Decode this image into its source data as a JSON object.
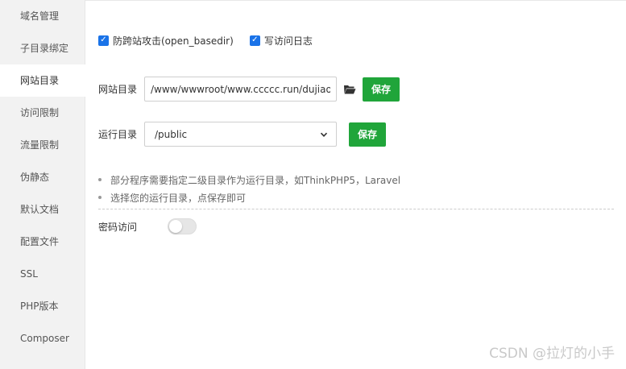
{
  "sidebar": {
    "items": [
      {
        "label": "域名管理",
        "active": false
      },
      {
        "label": "子目录绑定",
        "active": false
      },
      {
        "label": "网站目录",
        "active": true
      },
      {
        "label": "访问限制",
        "active": false
      },
      {
        "label": "流量限制",
        "active": false
      },
      {
        "label": "伪静态",
        "active": false
      },
      {
        "label": "默认文档",
        "active": false
      },
      {
        "label": "配置文件",
        "active": false
      },
      {
        "label": "SSL",
        "active": false
      },
      {
        "label": "PHP版本",
        "active": false
      },
      {
        "label": "Composer",
        "active": false
      }
    ]
  },
  "options": {
    "anti_xss": {
      "label": "防跨站攻击(open_basedir)",
      "checked": true
    },
    "access_log": {
      "label": "写访问日志",
      "checked": true
    }
  },
  "site_dir": {
    "label": "网站目录",
    "value": "/www/wwwroot/www.ccccc.run/dujiaoka",
    "folder_icon": "folder-open-icon",
    "save_label": "保存"
  },
  "run_dir": {
    "label": "运行目录",
    "selected": "/public",
    "save_label": "保存"
  },
  "tips": [
    "部分程序需要指定二级目录作为运行目录，如ThinkPHP5，Laravel",
    "选择您的运行目录，点保存即可"
  ],
  "password_access": {
    "label": "密码访问",
    "enabled": false
  },
  "watermark": "CSDN @拉灯的小手",
  "colors": {
    "accent": "#20a53a",
    "checkbox": "#1a73e8",
    "sidebar_bg": "#f2f2f2"
  }
}
